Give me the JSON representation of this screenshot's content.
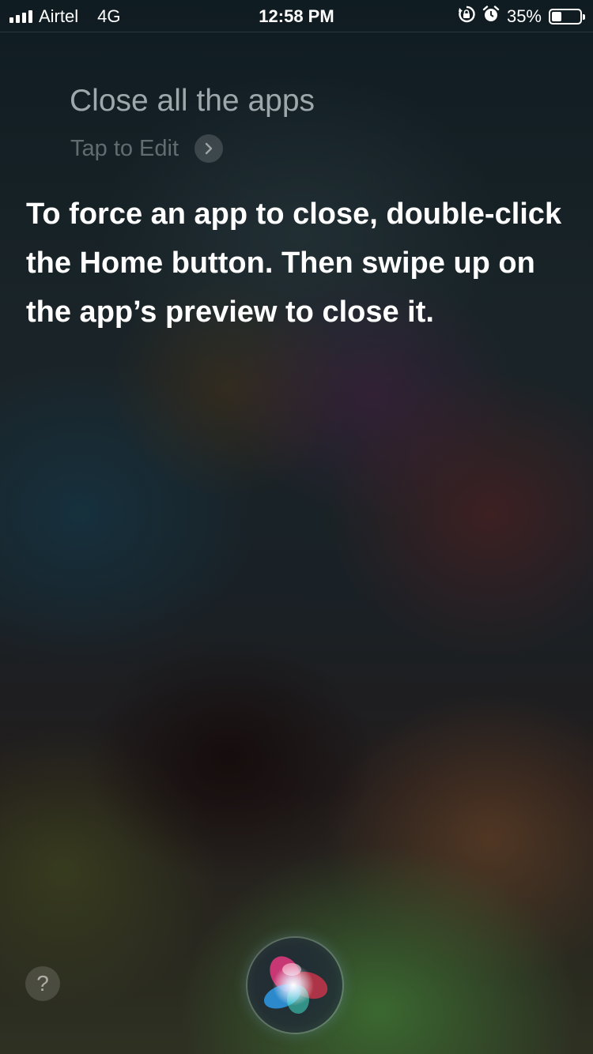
{
  "status_bar": {
    "carrier": "Airtel",
    "network": "4G",
    "time": "12:58 PM",
    "battery_percent": "35%",
    "battery_level": 0.35,
    "icons": [
      "signal-icon",
      "orientation-lock-icon",
      "alarm-icon",
      "battery-icon"
    ]
  },
  "siri": {
    "query": "Close all the apps",
    "tap_to_edit": "Tap to Edit",
    "response": "To force an app to close, double-click the Home button. Then swipe up on the app’s preview to close it.",
    "help_label": "?",
    "icons": [
      "chevron-right-icon",
      "siri-orb-icon"
    ]
  }
}
